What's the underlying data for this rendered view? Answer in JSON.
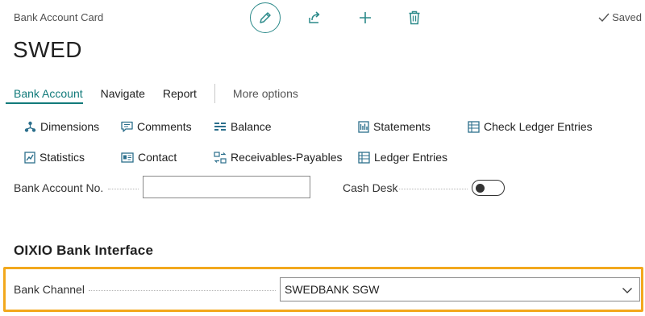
{
  "header": {
    "card_type": "Bank Account Card",
    "title": "SWED",
    "saved_label": "Saved"
  },
  "icons": {
    "edit": "pencil-icon",
    "share": "share-icon",
    "new": "plus-icon",
    "delete": "trash-icon",
    "saved": "checkmark-icon"
  },
  "tabs": [
    {
      "label": "Bank Account",
      "active": true
    },
    {
      "label": "Navigate"
    },
    {
      "label": "Report"
    },
    {
      "label": "More options"
    }
  ],
  "actions": {
    "dimensions": "Dimensions",
    "comments": "Comments",
    "balance": "Balance",
    "statements": "Statements",
    "check_ledger_entries": "Check Ledger Entries",
    "statistics": "Statistics",
    "contact": "Contact",
    "receivables_payables": "Receivables-Payables",
    "ledger_entries": "Ledger Entries"
  },
  "fields": {
    "bank_account_no": {
      "label": "Bank Account No.",
      "value": ""
    },
    "cash_desk": {
      "label": "Cash Desk",
      "value": "off"
    }
  },
  "section": {
    "title": "OIXIO Bank Interface",
    "bank_channel": {
      "label": "Bank Channel",
      "value": "SWEDBANK SGW"
    }
  },
  "colors": {
    "accent": "#117a7a",
    "highlight": "#f2a81d"
  }
}
